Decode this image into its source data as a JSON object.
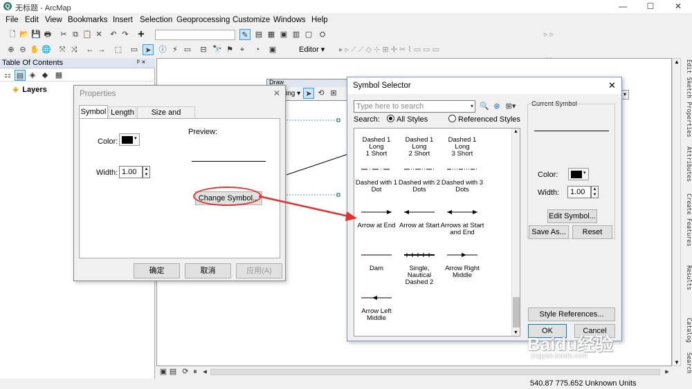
{
  "window": {
    "title": "无标题 - ArcMap",
    "app_icon": "arcmap-icon"
  },
  "menubar": {
    "items": [
      "File",
      "Edit",
      "View",
      "Bookmarks",
      "Insert",
      "Selection",
      "Geoprocessing",
      "Customize",
      "Windows",
      "Help"
    ]
  },
  "toolbar": {
    "editor_label": "Editor"
  },
  "toc": {
    "title": "Table Of Contents",
    "pin": "ᵖ ×",
    "layers_label": "Layers"
  },
  "draw_toolbar": {
    "title": "Draw",
    "partial_label": "ing"
  },
  "right_dock": {
    "tabs": [
      "Edit Sketch Properties",
      "Attributes",
      "Create Features",
      "Results",
      "Catalog",
      "Search"
    ]
  },
  "properties_dialog": {
    "title": "Properties",
    "tabs": [
      "Symbol",
      "Length",
      "Size and Position"
    ],
    "active_tab": "Symbol",
    "color_label": "Color:",
    "width_label": "Width:",
    "width_value": "1.00",
    "preview_label": "Preview:",
    "change_symbol_label": "Change Symbol...",
    "ok_label": "确定",
    "cancel_label": "取消",
    "apply_label": "应用(A)"
  },
  "symbol_selector": {
    "title": "Symbol Selector",
    "search_placeholder": "Type here to search",
    "search_label": "Search:",
    "all_styles_label": "All Styles",
    "referenced_styles_label": "Referenced Styles",
    "search_scope": "All Styles",
    "symbols": [
      {
        "name": "Dashed 1 Long\n1 Short",
        "pattern": "dash-long-short"
      },
      {
        "name": "Dashed 1 Long\n2 Short",
        "pattern": "dash-long-2short"
      },
      {
        "name": "Dashed 1 Long\n3 Short",
        "pattern": "dash-long-3short"
      },
      {
        "name": "Dashed with 1\nDot",
        "pattern": "dash-1dot"
      },
      {
        "name": "Dashed with 2\nDots",
        "pattern": "dash-2dots"
      },
      {
        "name": "Dashed with 3\nDots",
        "pattern": "dash-3dots"
      },
      {
        "name": "Arrow at End",
        "pattern": "arrow-end"
      },
      {
        "name": "Arrow at Start",
        "pattern": "arrow-start"
      },
      {
        "name": "Arrows at Start\nand End",
        "pattern": "arrow-both"
      },
      {
        "name": "Dam",
        "pattern": "solid"
      },
      {
        "name": "Single, Nautical\nDashed 2",
        "pattern": "nautical"
      },
      {
        "name": "Arrow Right\nMiddle",
        "pattern": "arrow-right-mid"
      },
      {
        "name": "Arrow Left\nMiddle",
        "pattern": "arrow-left-mid"
      }
    ],
    "current_symbol_label": "Current Symbol",
    "color_label": "Color:",
    "width_label": "Width:",
    "width_value": "1.00",
    "edit_symbol_label": "Edit Symbol...",
    "save_as_label": "Save As...",
    "reset_label": "Reset",
    "style_references_label": "Style References...",
    "ok_label": "OK",
    "cancel_label": "Cancel"
  },
  "status_bar": {
    "coordinates": "540.87  775.652 Unknown Units"
  },
  "watermark": {
    "brand": "Baidu经验",
    "url": "jingyan.baidu.com"
  },
  "colors": {
    "annotation_red": "#e03030",
    "selection_blue": "#0078d7",
    "symbol_black": "#000000"
  }
}
